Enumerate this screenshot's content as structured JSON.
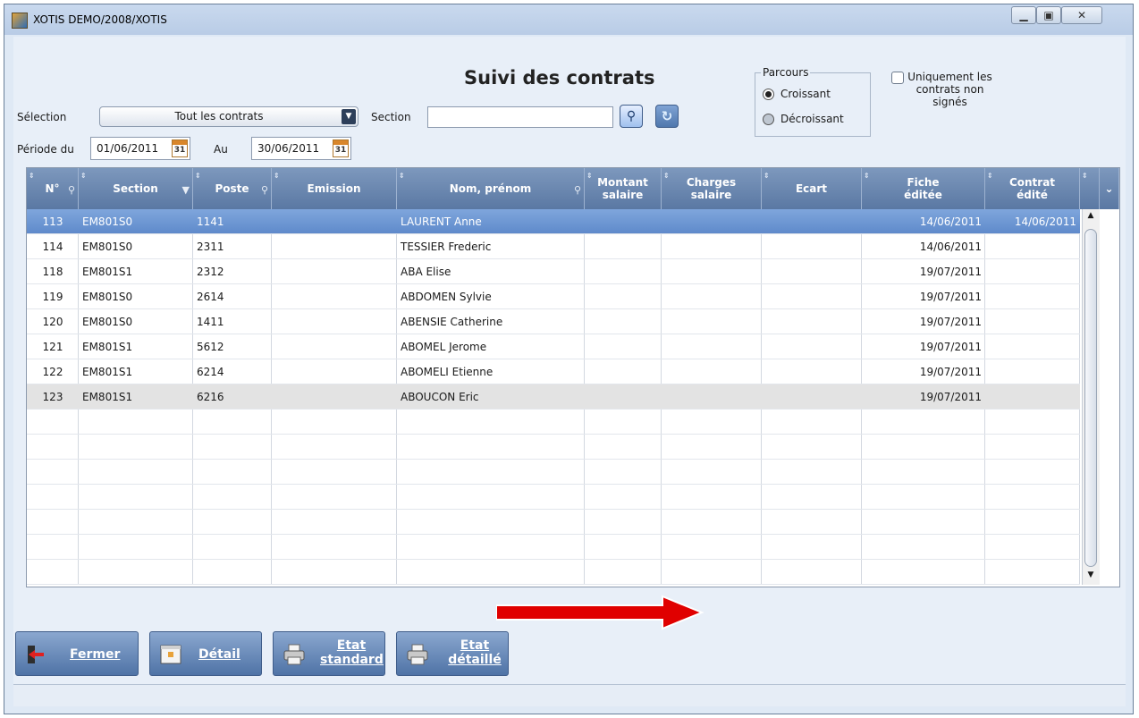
{
  "window": {
    "title": "XOTIS DEMO/2008/XOTIS"
  },
  "page": {
    "title": "Suivi des contrats"
  },
  "filters": {
    "selection_label": "Sélection",
    "selection_value": "Tout les contrats",
    "section_label": "Section",
    "section_value": "",
    "period_label": "Période du",
    "period_from": "01/06/2011",
    "period_to_label": "Au",
    "period_to": "30/06/2011",
    "calendar_day": "31"
  },
  "parcours": {
    "legend": "Parcours",
    "options": [
      {
        "label": "Croissant",
        "selected": true
      },
      {
        "label": "Décroissant",
        "selected": false
      }
    ]
  },
  "unsigned_only": {
    "label": "Uniquement les contrats non signés",
    "checked": false
  },
  "table": {
    "columns": [
      "N°",
      "Section",
      "Poste",
      "Emission",
      "Nom, prénom",
      "Montant salaire",
      "Charges salaire",
      "Ecart",
      "Fiche éditée",
      "Contrat édité"
    ],
    "rows": [
      {
        "num": "113",
        "section": "EM801S0",
        "poste": "1141",
        "emission": "",
        "nom": "LAURENT Anne",
        "montant": "",
        "charges": "",
        "ecart": "",
        "fiche": "14/06/2011",
        "contrat": "14/06/2011"
      },
      {
        "num": "114",
        "section": "EM801S0",
        "poste": "2311",
        "emission": "",
        "nom": "TESSIER Frederic",
        "montant": "",
        "charges": "",
        "ecart": "",
        "fiche": "14/06/2011",
        "contrat": ""
      },
      {
        "num": "118",
        "section": "EM801S1",
        "poste": "2312",
        "emission": "",
        "nom": "ABA Elise",
        "montant": "",
        "charges": "",
        "ecart": "",
        "fiche": "19/07/2011",
        "contrat": ""
      },
      {
        "num": "119",
        "section": "EM801S0",
        "poste": "2614",
        "emission": "",
        "nom": "ABDOMEN Sylvie",
        "montant": "",
        "charges": "",
        "ecart": "",
        "fiche": "19/07/2011",
        "contrat": ""
      },
      {
        "num": "120",
        "section": "EM801S0",
        "poste": "1411",
        "emission": "",
        "nom": "ABENSIE Catherine",
        "montant": "",
        "charges": "",
        "ecart": "",
        "fiche": "19/07/2011",
        "contrat": ""
      },
      {
        "num": "121",
        "section": "EM801S1",
        "poste": "5612",
        "emission": "",
        "nom": "ABOMEL Jerome",
        "montant": "",
        "charges": "",
        "ecart": "",
        "fiche": "19/07/2011",
        "contrat": ""
      },
      {
        "num": "122",
        "section": "EM801S1",
        "poste": "6214",
        "emission": "",
        "nom": "ABOMELI Etienne",
        "montant": "",
        "charges": "",
        "ecart": "",
        "fiche": "19/07/2011",
        "contrat": ""
      },
      {
        "num": "123",
        "section": "EM801S1",
        "poste": "6216",
        "emission": "",
        "nom": "ABOUCON Eric",
        "montant": "",
        "charges": "",
        "ecart": "",
        "fiche": "19/07/2011",
        "contrat": ""
      }
    ]
  },
  "buttons": {
    "fermer": "Fermer",
    "detail": "Détail",
    "etat_standard": [
      "Etat",
      "standard"
    ],
    "etat_detaille": [
      "Etat",
      "détaillé"
    ]
  },
  "colors": {
    "header": "#5a78a3",
    "selected_row": "#6f98d4",
    "annotation_arrow": "#e00000"
  }
}
